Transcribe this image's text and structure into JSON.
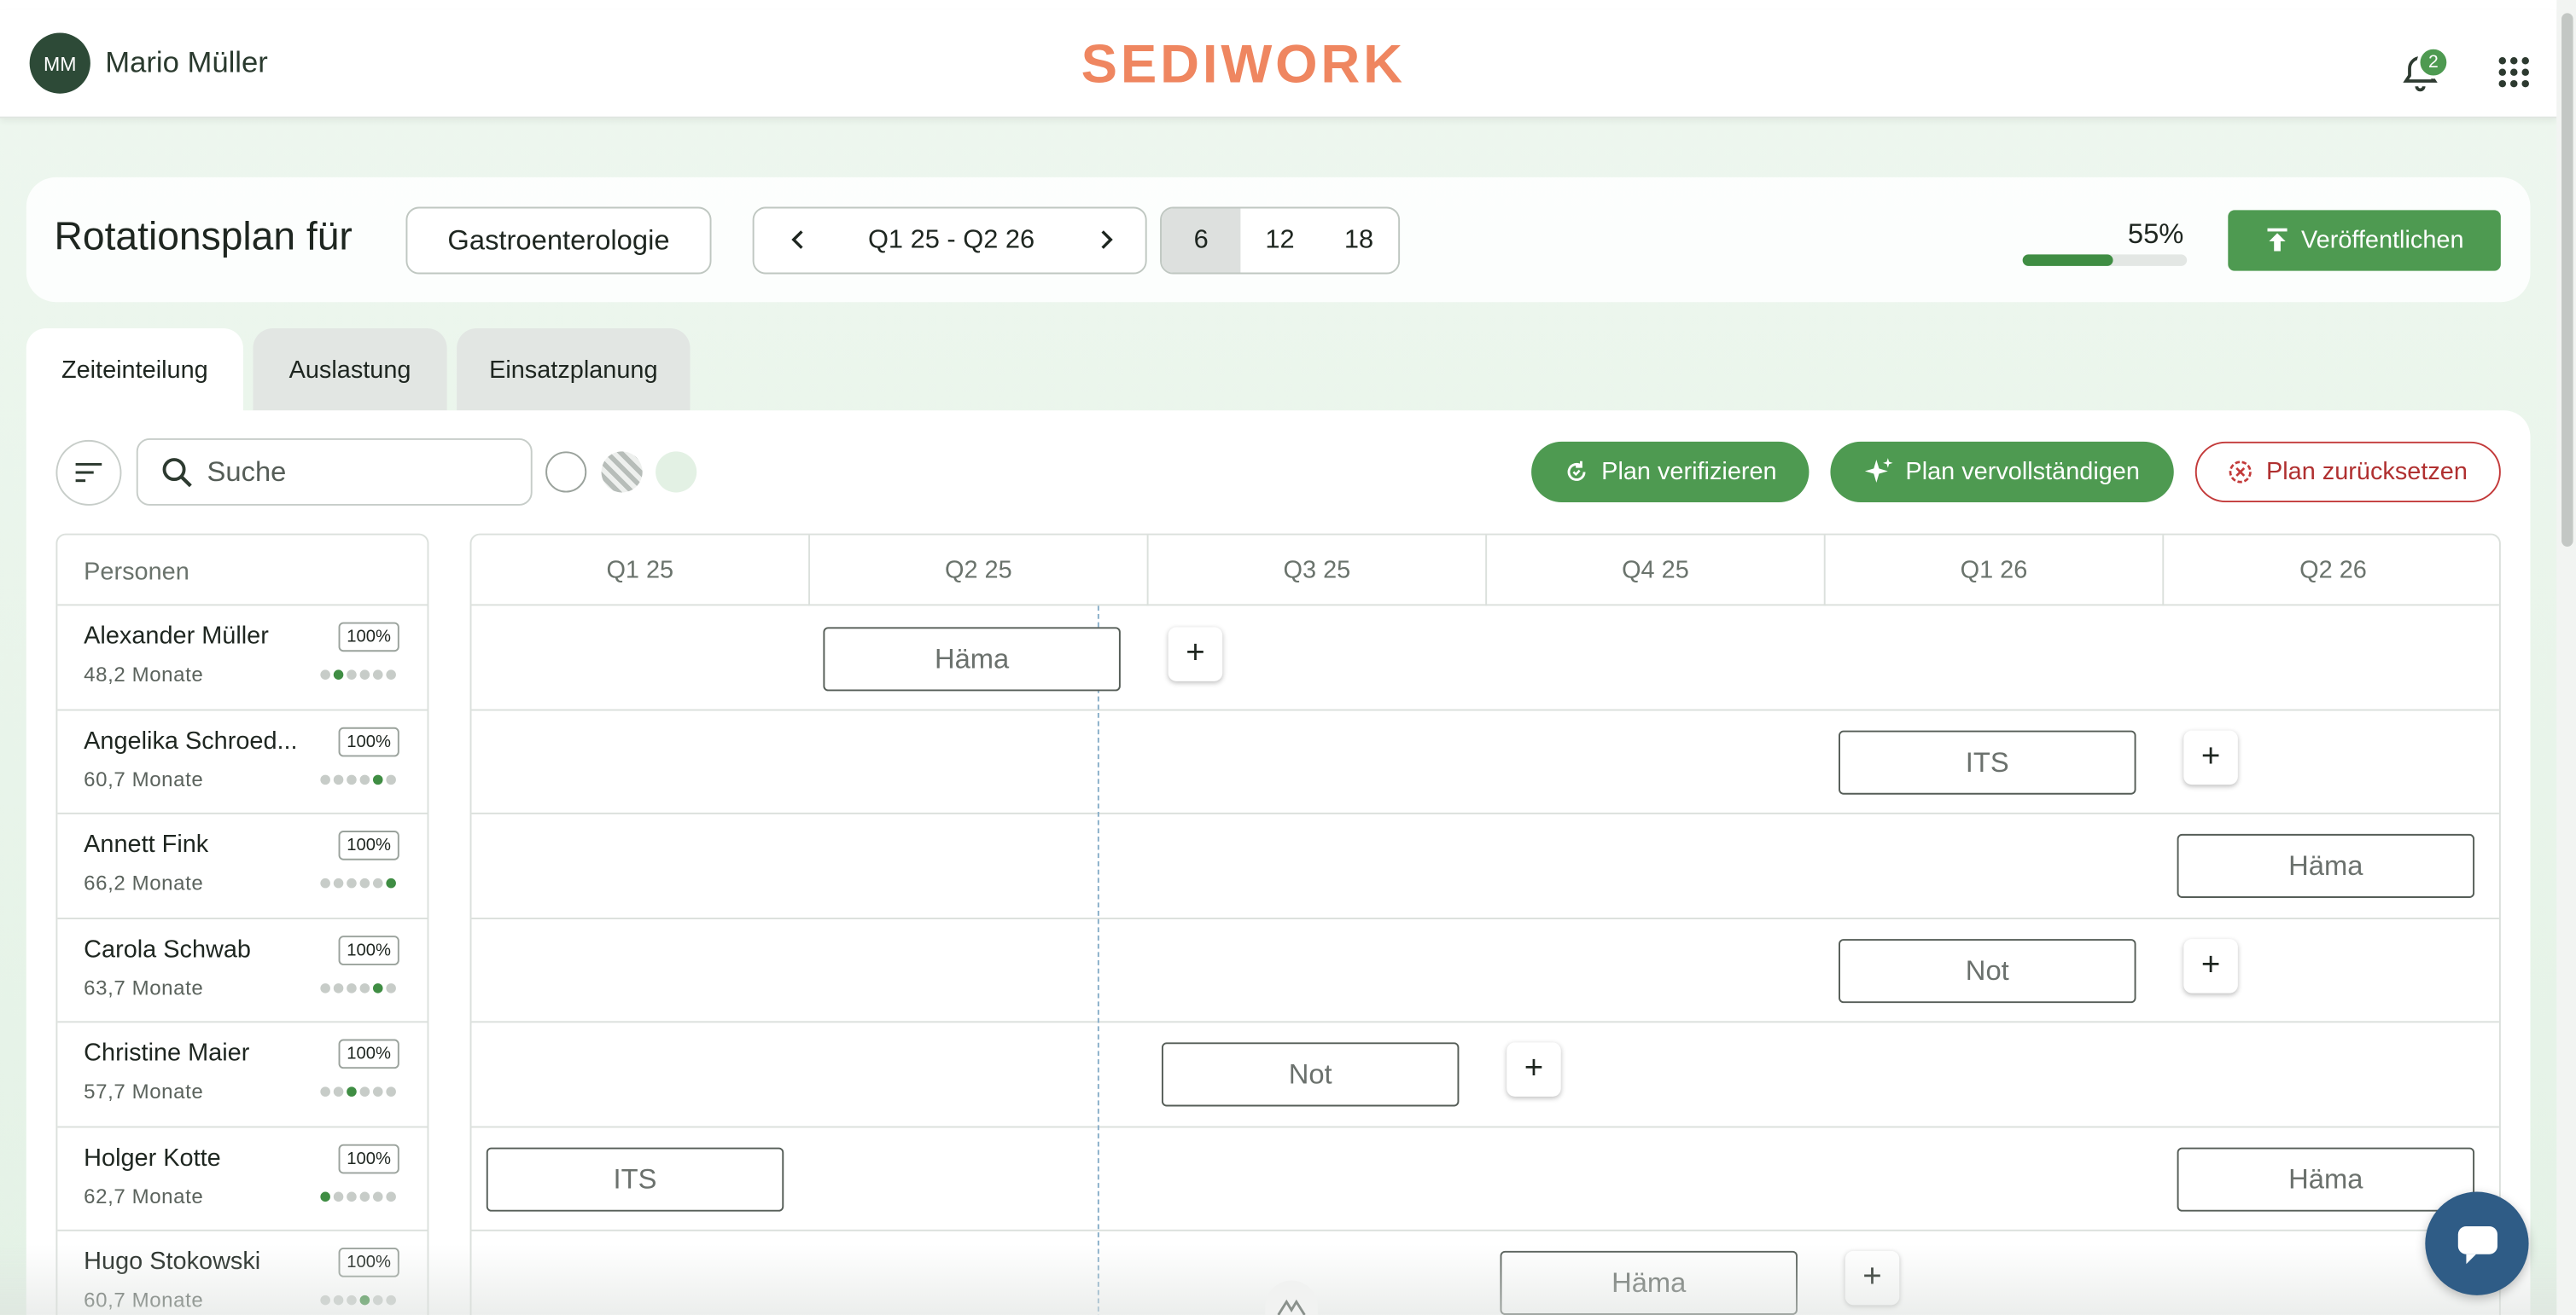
{
  "user": {
    "initials": "MM",
    "name": "Mario Müller"
  },
  "brand": {
    "logo_text": "SEDIWORK",
    "color": "#ef8660"
  },
  "header": {
    "notification_count": "2",
    "bell_icon": "bell-icon",
    "apps_icon": "grid-apps-icon"
  },
  "plan": {
    "title": "Rotationsplan für",
    "department": "Gastroenterologie",
    "range_label": "Q1 25 - Q2 26",
    "segments": [
      "6",
      "12",
      "18"
    ],
    "active_segment": "6",
    "progress_label": "55%",
    "progress_value": 0.55,
    "publish_label": "Veröffentlichen"
  },
  "tabs": [
    {
      "label": "Zeiteinteilung",
      "active": true
    },
    {
      "label": "Auslastung",
      "active": false
    },
    {
      "label": "Einsatzplanung",
      "active": false
    }
  ],
  "toolbar": {
    "search_placeholder": "Suche",
    "verify_label": "Plan verifizieren",
    "complete_label": "Plan vervollständigen",
    "reset_label": "Plan zurücksetzen"
  },
  "persons_header": "Personen",
  "quarters": [
    "Q1 25",
    "Q2 25",
    "Q3 25",
    "Q4 25",
    "Q1 26",
    "Q2 26"
  ],
  "persons": [
    {
      "name": "Alexander Müller",
      "months": "48,2 Monate",
      "pct": "100%",
      "level": 2
    },
    {
      "name": "Angelika Schroed...",
      "months": "60,7 Monate",
      "pct": "100%",
      "level": 5
    },
    {
      "name": "Annett Fink",
      "months": "66,2 Monate",
      "pct": "100%",
      "level": 6
    },
    {
      "name": "Carola Schwab",
      "months": "63,7 Monate",
      "pct": "100%",
      "level": 5
    },
    {
      "name": "Christine Maier",
      "months": "57,7 Monate",
      "pct": "100%",
      "level": 3
    },
    {
      "name": "Holger Kotte",
      "months": "62,7 Monate",
      "pct": "100%",
      "level": 1
    },
    {
      "name": "Hugo Stokowski",
      "months": "60,7 Monate",
      "pct": "100%",
      "level": 4
    }
  ],
  "assignments": [
    {
      "row": 0,
      "label": "Häma"
    },
    {
      "row": 1,
      "label": "ITS"
    },
    {
      "row": 2,
      "label": "Häma"
    },
    {
      "row": 3,
      "label": "Not"
    },
    {
      "row": 4,
      "label": "Not"
    },
    {
      "row": 5,
      "label": "ITS"
    },
    {
      "row": 5,
      "label": "Häma"
    },
    {
      "row": 6,
      "label": "Häma"
    }
  ],
  "colors": {
    "accent": "#4e9a51",
    "danger": "#c33a3a",
    "chat": "#2f5c86"
  }
}
